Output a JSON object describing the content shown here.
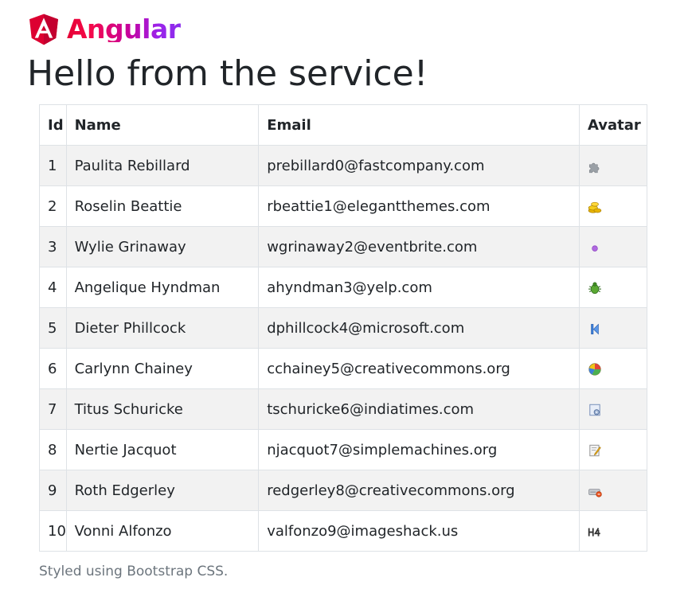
{
  "brand": {
    "name": "Angular",
    "logo_icon": "angular-logo-icon",
    "colors": {
      "shield_red": "#dd0031",
      "gradient_start": "#e40035",
      "gradient_end": "#8b2ded"
    }
  },
  "page_title": "Hello from the service!",
  "table": {
    "headers": {
      "id": "Id",
      "name": "Name",
      "email": "Email",
      "avatar": "Avatar"
    },
    "rows": [
      {
        "id": "1",
        "name": "Paulita Rebillard",
        "email": "prebillard0@fastcompany.com",
        "avatar_icon": "puzzle-piece-icon"
      },
      {
        "id": "2",
        "name": "Roselin Beattie",
        "email": "rbeattie1@elegantthemes.com",
        "avatar_icon": "coins-icon"
      },
      {
        "id": "3",
        "name": "Wylie Grinaway",
        "email": "wgrinaway2@eventbrite.com",
        "avatar_icon": "purple-dot-icon"
      },
      {
        "id": "4",
        "name": "Angelique Hyndman",
        "email": "ahyndman3@yelp.com",
        "avatar_icon": "bug-icon"
      },
      {
        "id": "5",
        "name": "Dieter Phillcock",
        "email": "dphillcock4@microsoft.com",
        "avatar_icon": "skip-back-icon"
      },
      {
        "id": "6",
        "name": "Carlynn Chainey",
        "email": "cchainey5@creativecommons.org",
        "avatar_icon": "pie-chart-icon"
      },
      {
        "id": "7",
        "name": "Titus Schuricke",
        "email": "tschuricke6@indiatimes.com",
        "avatar_icon": "page-gear-icon"
      },
      {
        "id": "8",
        "name": "Nertie Jacquot",
        "email": "njacquot7@simplemachines.org",
        "avatar_icon": "page-edit-icon"
      },
      {
        "id": "9",
        "name": "Roth Edgerley",
        "email": "redgerley8@creativecommons.org",
        "avatar_icon": "drive-error-icon"
      },
      {
        "id": "10",
        "name": "Vonni Alfonzo",
        "email": "valfonzo9@imageshack.us",
        "avatar_icon": "heading-h4-icon"
      }
    ]
  },
  "footer": {
    "note": "Styled using Bootstrap CSS."
  }
}
